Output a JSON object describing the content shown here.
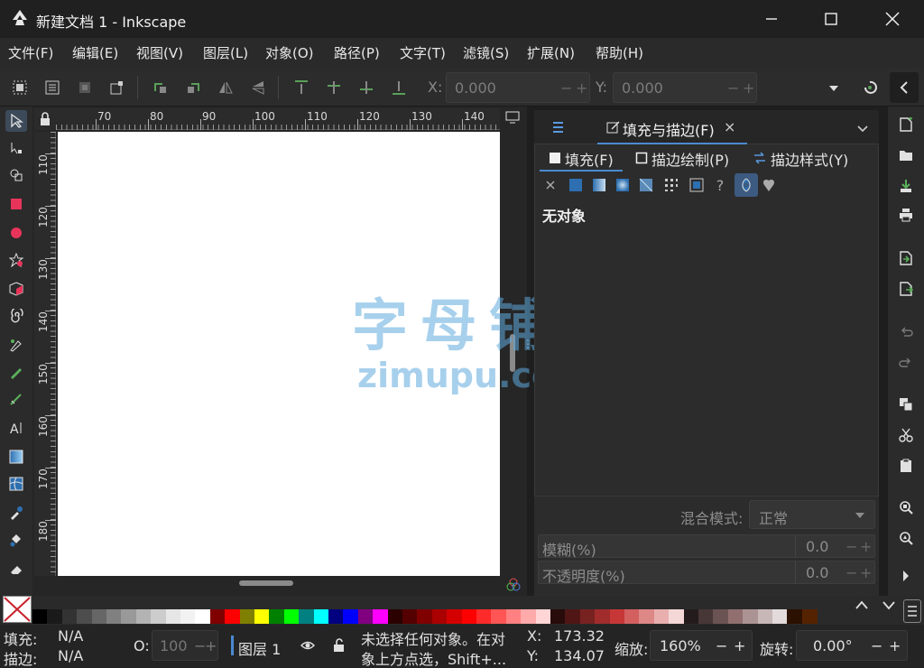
{
  "window": {
    "title": "新建文档 1 - Inkscape",
    "minimize_icon": "minimize-icon",
    "maximize_icon": "maximize-icon",
    "close_icon": "close-icon"
  },
  "menu": [
    "文件(F)",
    "编辑(E)",
    "视图(V)",
    "图层(L)",
    "对象(O)",
    "路径(P)",
    "文字(T)",
    "滤镜(S)",
    "扩展(N)",
    "帮助(H)"
  ],
  "toolbar": {
    "x_label": "X:",
    "x_value": "0.000",
    "y_label": "Y:",
    "y_value": "0.000",
    "minus": "−",
    "plus": "+"
  },
  "rulers": {
    "horizontal": [
      "70",
      "80",
      "90",
      "100",
      "110",
      "120",
      "130",
      "140"
    ],
    "vertical": [
      "110",
      "120",
      "130",
      "140",
      "150",
      "160",
      "170",
      "180"
    ]
  },
  "dock": {
    "tab_label": "填充与描边(F)",
    "tab_close": "×",
    "sub_tabs": [
      "填充(F)",
      "描边绘制(P)",
      "描边样式(Y)"
    ],
    "paint_unset": "?",
    "no_object": "无对象",
    "blend_label": "混合模式:",
    "blend_value": "正常",
    "blur_label": "模糊(%)",
    "blur_value": "0.0",
    "opacity_label": "不透明度(%)",
    "opacity_value": "0.0",
    "minus": "−",
    "plus": "+"
  },
  "palette_colors": [
    "#000000",
    "#1a1a1a",
    "#333333",
    "#4d4d4d",
    "#666666",
    "#808080",
    "#999999",
    "#b3b3b3",
    "#cccccc",
    "#e6e6e6",
    "#f2f2f2",
    "#ffffff",
    "#800000",
    "#ff0000",
    "#808000",
    "#ffff00",
    "#008000",
    "#00ff00",
    "#008080",
    "#00ffff",
    "#000080",
    "#0000ff",
    "#800080",
    "#ff00ff",
    "#2b0000",
    "#550000",
    "#800000",
    "#aa0000",
    "#d40000",
    "#ff0000",
    "#ff2a2a",
    "#ff5555",
    "#ff8080",
    "#ffaaaa",
    "#ffd5d5",
    "#280b0b",
    "#501616",
    "#782121",
    "#a02c2c",
    "#c83737",
    "#d35f5f",
    "#de8787",
    "#e9afaf",
    "#f4d7d7",
    "#241c1c",
    "#483737",
    "#6c5353",
    "#916f6f",
    "#ac9393",
    "#c8b7b7",
    "#e3dbdb",
    "#2b1100",
    "#552200"
  ],
  "status": {
    "fill_label": "填充:",
    "fill_value": "N/A",
    "stroke_label": "描边:",
    "stroke_value": "N/A",
    "opacity_label": "O:",
    "opacity_value": "100",
    "layer_label": "图层 1",
    "message_line1": "未选择任何对象。在对",
    "message_line2": "象上方点选，Shift+...",
    "x_label": "X:",
    "x_value": "173.32",
    "y_label": "Y:",
    "y_value": "134.07",
    "zoom_label": "缩放:",
    "zoom_value": "160%",
    "rotate_label": "旋转:",
    "rotate_value": "0.00°",
    "minus": "−",
    "plus": "+"
  },
  "watermark": {
    "cn": "字母铺",
    "en": "zimupu.com"
  }
}
